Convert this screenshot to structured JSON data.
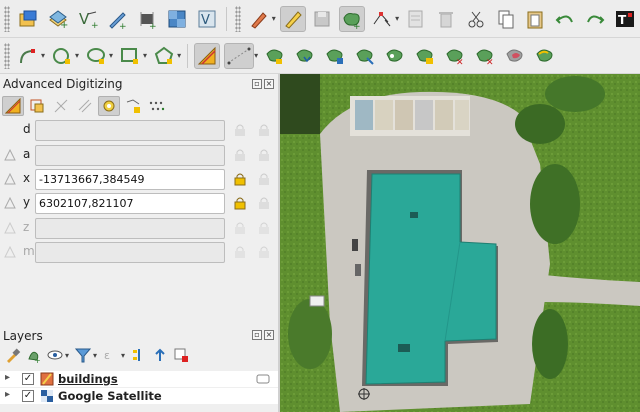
{
  "toolbar_top": {
    "icons": [
      "open-project-icon",
      "new-layer-icon",
      "new-vector-layer-icon",
      "digitize-pen-icon",
      "hardware-chip-icon",
      "raster-calculator-icon",
      "vector-check-icon",
      "edit-pencil-icon",
      "toggle-editing-icon",
      "save-edits-icon",
      "add-polygon-icon",
      "vertex-tool-icon",
      "attribute-table-icon",
      "delete-icon",
      "cut-features-icon",
      "copy-features-icon",
      "paste-features-icon",
      "undo-icon",
      "redo-icon",
      "text-annotation-icon"
    ]
  },
  "toolbar_second": {
    "icons": [
      "node-tool-icon",
      "circle-tool-icon",
      "move-tool-icon",
      "rectangle-tool-icon",
      "rotate-tool-icon",
      "advanced-digitizing-icon",
      "snapping-line-icon",
      "reshape-features-icon",
      "offset-curve-icon",
      "split-features-icon",
      "split-parts-icon",
      "merge-features-icon",
      "merge-attributes-icon",
      "rotate-point-icon",
      "fill-ring-icon",
      "delete-ring-icon",
      "delete-part-icon",
      "simplify-icon"
    ]
  },
  "advanced_digitizing": {
    "title": "Advanced Digitizing",
    "fields": [
      {
        "label": "d",
        "value": "",
        "enabled": true
      },
      {
        "label": "a",
        "value": "",
        "enabled": true
      },
      {
        "label": "x",
        "value": "-13713667,384549",
        "enabled": true
      },
      {
        "label": "y",
        "value": "6302107,821107",
        "enabled": true
      },
      {
        "label": "z",
        "value": "",
        "enabled": false
      },
      {
        "label": "m",
        "value": "",
        "enabled": false
      }
    ]
  },
  "layers_panel": {
    "title": "Layers",
    "layers": [
      {
        "name": "buildings",
        "checked": true,
        "icon": "polygon-layer-icon"
      },
      {
        "name": "Google Satellite",
        "checked": true,
        "icon": "raster-tile-icon"
      }
    ]
  },
  "colors": {
    "roof": "#2aa898",
    "grass": "#5f8f2f",
    "pavement": "#c9c6bf",
    "highlight": "#f0c000"
  }
}
